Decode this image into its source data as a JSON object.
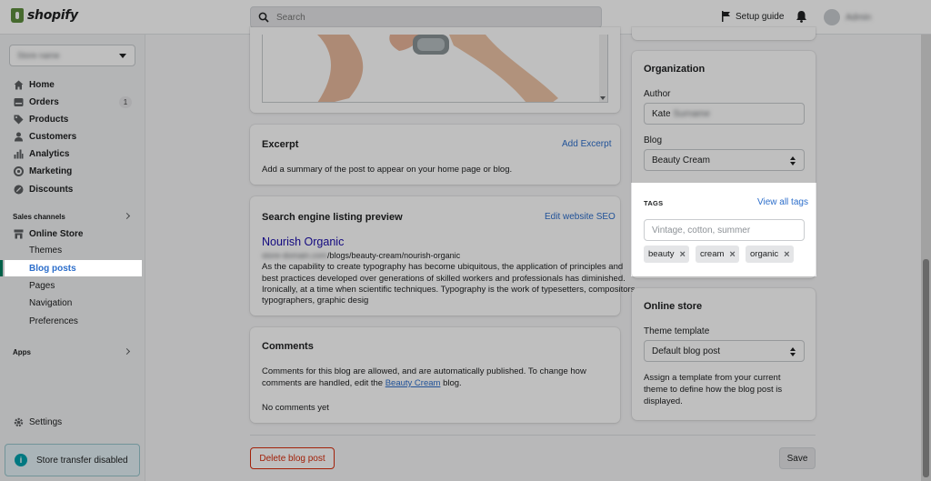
{
  "topbar": {
    "logo_text": "shopify",
    "search_placeholder": "Search",
    "setup_guide": "Setup guide",
    "account_name": "Admin"
  },
  "sidebar": {
    "store_name": "Store name",
    "items": [
      {
        "label": "Home",
        "icon": "home-icon"
      },
      {
        "label": "Orders",
        "icon": "orders-icon",
        "badge": "1"
      },
      {
        "label": "Products",
        "icon": "tag-icon"
      },
      {
        "label": "Customers",
        "icon": "person-icon"
      },
      {
        "label": "Analytics",
        "icon": "analytics-icon"
      },
      {
        "label": "Marketing",
        "icon": "marketing-icon"
      },
      {
        "label": "Discounts",
        "icon": "discount-icon"
      }
    ],
    "sales_channels_label": "Sales channels",
    "online_store_label": "Online Store",
    "online_store_subitems": [
      "Themes",
      "Blog posts",
      "Pages",
      "Navigation",
      "Preferences"
    ],
    "apps_label": "Apps",
    "settings_label": "Settings",
    "transfer_label": "Store transfer disabled"
  },
  "excerpt": {
    "title": "Excerpt",
    "action": "Add Excerpt",
    "description": "Add a summary of the post to appear on your home page or blog."
  },
  "seo": {
    "title": "Search engine listing preview",
    "action": "Edit website SEO",
    "page_title": "Nourish Organic",
    "url_path": "/blogs/beauty-cream/nourish-organic",
    "url_host": "store-domain.com",
    "snippet_1": "As the capability to create typography has become ubiquitous, the application of principles and",
    "snippet_2": "best practices developed over generations of skilled workers and professionals has diminished.",
    "snippet_3": "Ironically, at a time when scientific techniques. Typography is the work of typesetters, compositors,",
    "snippet_4": "typographers, graphic desig"
  },
  "comments": {
    "title": "Comments",
    "text_1": "Comments for this blog are allowed, and are automatically published. To change how",
    "text_2_before": "comments are handled, edit the ",
    "text_2_link": "Beauty Cream",
    "text_2_after": " blog.",
    "empty": "No comments yet"
  },
  "organization": {
    "title": "Organization",
    "author_label": "Author",
    "author_first": "Kate",
    "author_last": "Surname",
    "blog_label": "Blog",
    "blog_value": "Beauty Cream"
  },
  "tags": {
    "title": "TAGS",
    "action": "View all tags",
    "placeholder": "Vintage, cotton, summer",
    "items": [
      "beauty",
      "cream",
      "organic"
    ]
  },
  "online_store": {
    "title": "Online store",
    "theme_label": "Theme template",
    "theme_value": "Default blog post",
    "help_1": "Assign a template from your current",
    "help_2": "theme to define how the blog post is",
    "help_3": "displayed."
  },
  "footer": {
    "delete_label": "Delete blog post",
    "save_label": "Save"
  },
  "colors": {
    "accent": "#2c6ecb",
    "shopify_green": "#5e8e3e",
    "danger": "#d82c0d"
  }
}
